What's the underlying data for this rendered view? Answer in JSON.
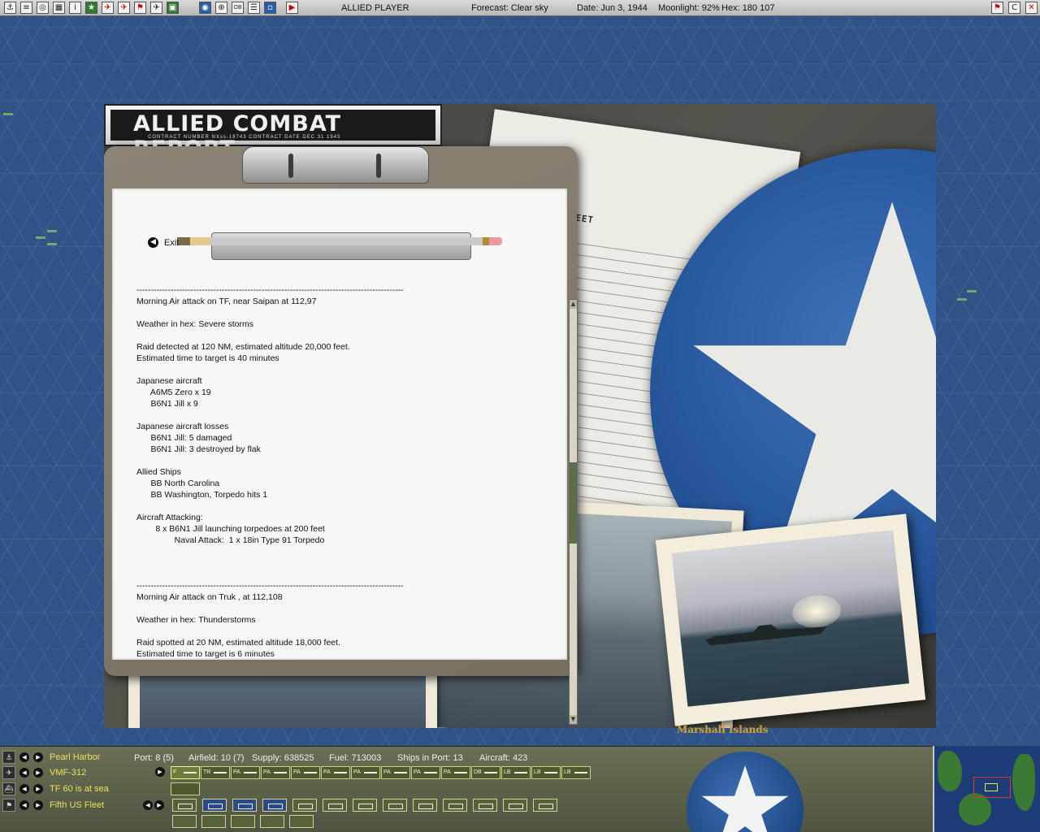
{
  "topbar": {
    "player": "ALLIED PLAYER",
    "forecast": "Forecast: Clear sky",
    "date": "Date: Jun 3, 1944",
    "moonlight": "Moonlight: 92%",
    "hex": "Hex: 180 107",
    "icons": [
      "anchor-icon",
      "notes-icon",
      "ship-icon",
      "combat-icon",
      "info-icon",
      "star-icon",
      "plane-red-icon",
      "plane-alt-icon",
      "flag-icon",
      "plane-map-icon",
      "map-icon",
      "globe-icon",
      "target-icon",
      "ob-icon",
      "list-icon",
      "window-icon",
      "end-turn-icon"
    ],
    "ob_label": "OB",
    "right_icons": [
      "flag-icon",
      "c-icon",
      "close-icon"
    ],
    "c_label": "C"
  },
  "report": {
    "title": "ALLIED COMBAT REPORT",
    "contract": "CONTRACT NUMBER  NXss-18743        CONTRACT DATE  DEC 31 1943",
    "doc_title": "TED STATES FLEET",
    "exit_label": "Exit",
    "lines": [
      "----------------------------------------------------------------------------------------------",
      "Morning Air attack on TF, near Saipan at 112,97",
      "",
      "Weather in hex: Severe storms",
      "",
      "Raid detected at 120 NM, estimated altitude 20,000 feet.",
      "Estimated time to target is 40 minutes",
      "",
      "Japanese aircraft",
      "      A6M5 Zero x 19",
      "      B6N1 Jill x 9",
      "",
      "Japanese aircraft losses",
      "      B6N1 Jill: 5 damaged",
      "      B6N1 Jill: 3 destroyed by flak",
      "",
      "Allied Ships",
      "      BB North Carolina",
      "      BB Washington, Torpedo hits 1",
      "",
      "Aircraft Attacking:",
      "        8 x B6N1 Jill launching torpedoes at 200 feet",
      "                Naval Attack:  1 x 18in Type 91 Torpedo",
      "",
      "",
      "",
      "----------------------------------------------------------------------------------------------",
      "Morning Air attack on Truk , at 112,108",
      "",
      "Weather in hex: Thunderstorms",
      "",
      "Raid spotted at 20 NM, estimated altitude 18,000 feet.",
      "Estimated time to target is 6 minutes"
    ]
  },
  "map": {
    "region_label": "Marshall Islands"
  },
  "bottom": {
    "base": "Pearl Harbor",
    "air_unit": "VMF-312",
    "task_force": "TF 60 is at sea",
    "fleet": "Fifth US Fleet",
    "port": "Port: 8 (5)",
    "airfield": "Airfield: 10 (7)",
    "supply": "Supply: 638525",
    "fuel": "Fuel: 713003",
    "ships_in_port": "Ships in Port: 13",
    "aircraft": "Aircraft: 423",
    "aircraft_buttons": [
      "F",
      "TR",
      "PA",
      "PA",
      "PA",
      "PA",
      "PA",
      "PA",
      "PA",
      "PA",
      "DB",
      "LB",
      "LB",
      "LB"
    ],
    "colors": {
      "accent_text": "#ece05a",
      "region_text": "#d9a12a",
      "ocean": "#2f5384"
    }
  }
}
